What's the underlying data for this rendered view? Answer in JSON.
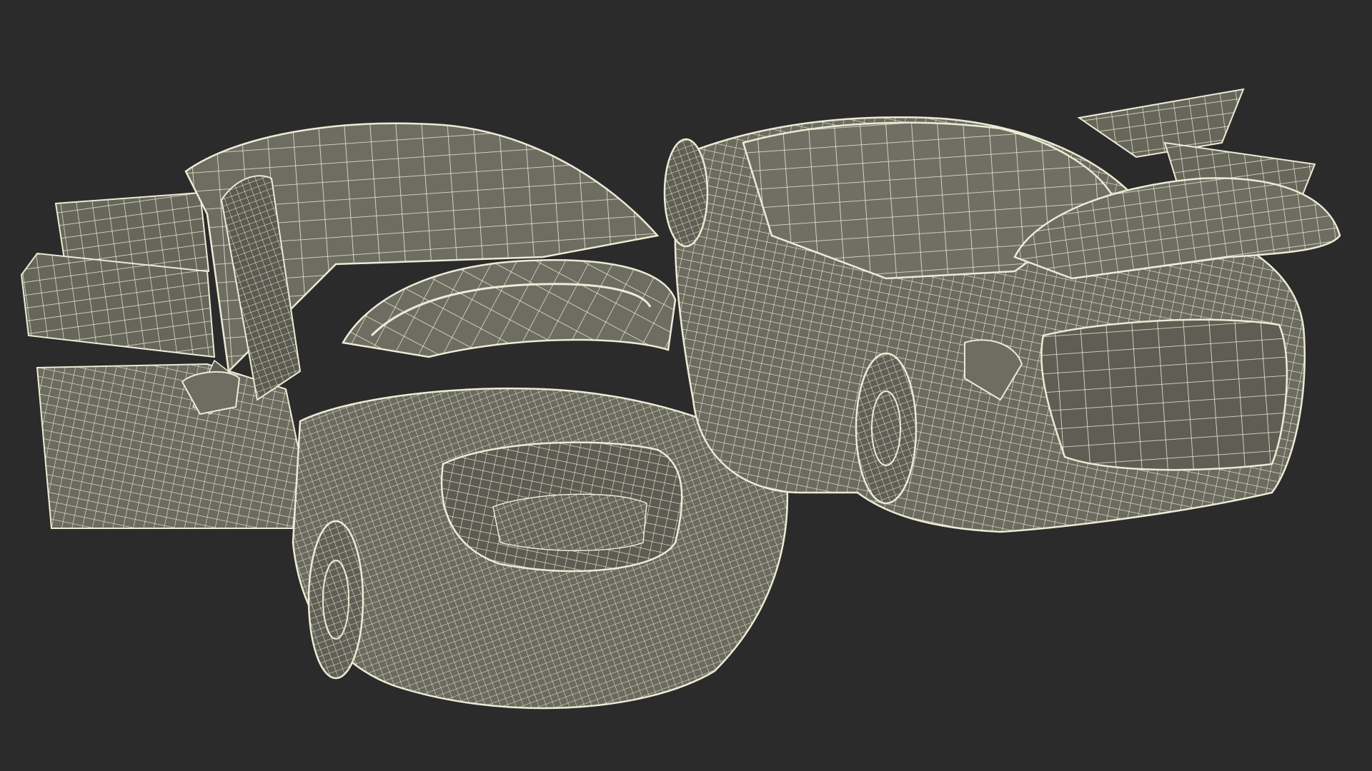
{
  "scene": {
    "background": "#2b2b2b",
    "surface_fill": "#6b6b5f",
    "surface_fill_dark": "#5a5a50",
    "interior_fill": "#626258",
    "wire_color": "#ecebd6",
    "models": [
      {
        "name": "car-front-view",
        "description_hidden": true
      },
      {
        "name": "car-rear-view",
        "description_hidden": true
      }
    ]
  }
}
